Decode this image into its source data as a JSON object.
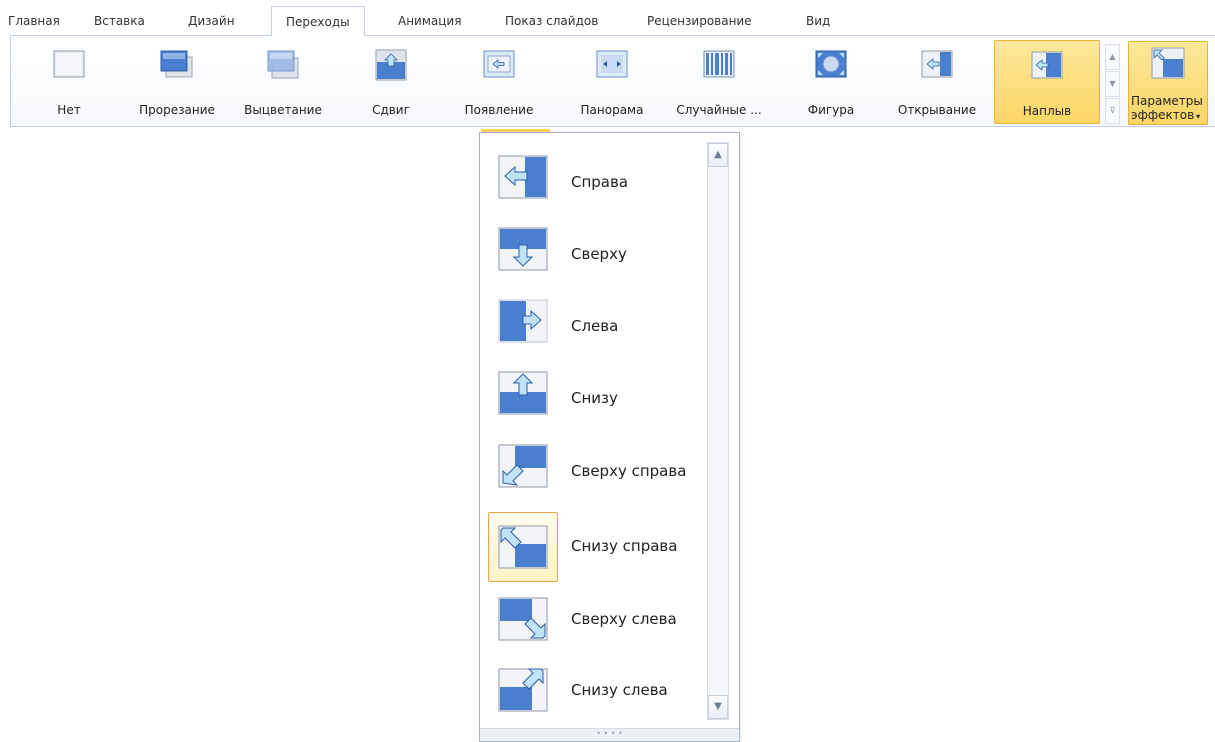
{
  "tabs": [
    "Главная",
    "Вставка",
    "Дизайн",
    "Переходы",
    "Анимация",
    "Показ слайдов",
    "Рецензирование",
    "Вид"
  ],
  "active_tab": "Переходы",
  "gallery": [
    {
      "label": "Нет",
      "icon": "none-transition-icon"
    },
    {
      "label": "Прорезание",
      "icon": "cut-transition-icon"
    },
    {
      "label": "Выцветание",
      "icon": "fade-transition-icon"
    },
    {
      "label": "Сдвиг",
      "icon": "push-transition-icon"
    },
    {
      "label": "Появление",
      "icon": "wipe-transition-icon"
    },
    {
      "label": "Панорама",
      "icon": "split-transition-icon"
    },
    {
      "label": "Случайные ...",
      "icon": "random-bars-transition-icon"
    },
    {
      "label": "Фигура",
      "icon": "shape-transition-icon"
    },
    {
      "label": "Открывание",
      "icon": "uncover-transition-icon"
    },
    {
      "label": "Наплыв",
      "icon": "cover-transition-icon",
      "selected": true
    }
  ],
  "effect_options": {
    "line1": "Параметры",
    "line2": "эффектов",
    "arrow": "▾"
  },
  "scroll_glyphs": {
    "up": "▲",
    "down": "▼",
    "more": "⊽"
  },
  "menu": {
    "items": [
      {
        "label": "Справа",
        "icon": "from-right-icon"
      },
      {
        "label": "Сверху",
        "icon": "from-top-icon"
      },
      {
        "label": "Слева",
        "icon": "from-left-icon"
      },
      {
        "label": "Снизу",
        "icon": "from-bottom-icon"
      },
      {
        "label": "Сверху справа",
        "icon": "from-top-right-icon"
      },
      {
        "label": "Снизу справа",
        "icon": "from-bottom-right-icon",
        "selected": true
      },
      {
        "label": "Сверху слева",
        "icon": "from-top-left-icon"
      },
      {
        "label": "Снизу слева",
        "icon": "from-bottom-left-icon"
      }
    ],
    "scroll_up": "▲",
    "scroll_down": "▼",
    "grip": "• • • •"
  },
  "colors": {
    "accent_selected": "#fbd665",
    "ribbon_border": "#c5d2e4",
    "icon_blue": "#4a7fd0"
  }
}
